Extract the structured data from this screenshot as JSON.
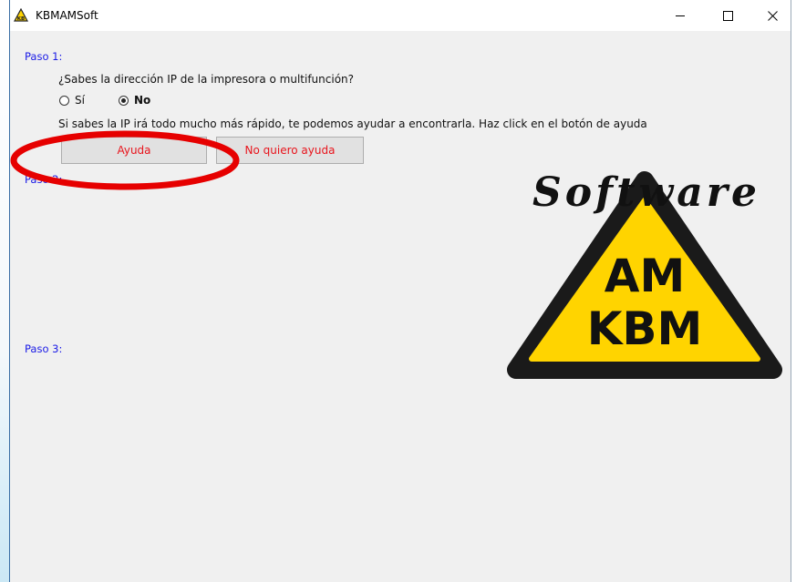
{
  "window": {
    "title": "KBMAMSoft"
  },
  "steps": {
    "paso1": "Paso 1:",
    "paso2": "Paso 2:",
    "paso3": "Paso 3:"
  },
  "question": {
    "text": "¿Sabes la dirección IP de la impresora o multifunción?",
    "options": [
      {
        "label": "Sí",
        "selected": false
      },
      {
        "label": "No",
        "selected": true
      }
    ]
  },
  "hint": "Si sabes la IP irá todo mucho más rápido, te podemos ayudar a encontrarla. Haz click en el botón de ayuda",
  "buttons": {
    "help": "Ayuda",
    "no_help": "No quiero ayuda"
  },
  "logo": {
    "script_text": "Software",
    "line1": "AM",
    "line2": "KBM"
  },
  "colors": {
    "step_label": "#1a1ae6",
    "button_text": "#e8141c",
    "annotation": "#e60000",
    "logo_yellow": "#ffd400"
  },
  "icons": {
    "app": "warning-triangle-icon",
    "minimize": "minimize-icon",
    "maximize": "maximize-icon",
    "close": "close-icon"
  }
}
